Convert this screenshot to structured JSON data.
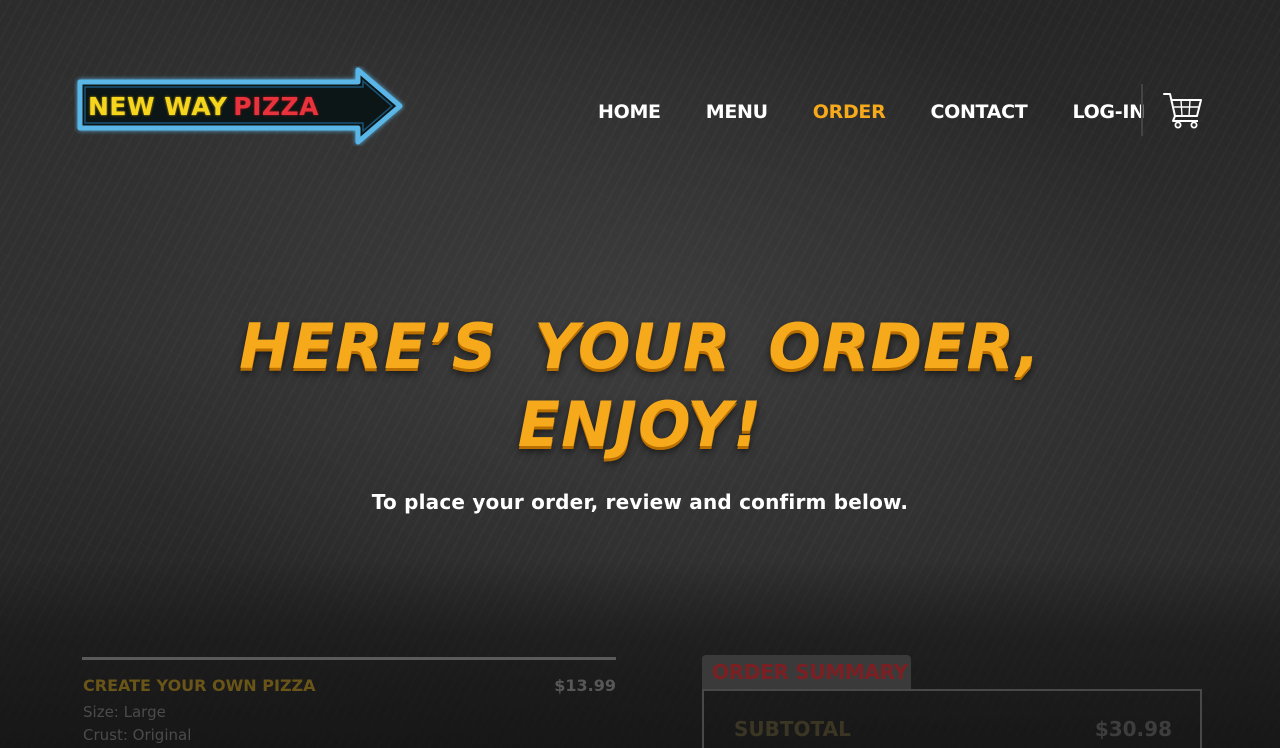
{
  "logo": {
    "word1": "NEW WAY",
    "word2": "PIZZA",
    "glow_color": "#5ab6e6"
  },
  "nav": {
    "items": [
      {
        "label": "HOME",
        "active": false
      },
      {
        "label": "MENU",
        "active": false
      },
      {
        "label": "ORDER",
        "active": true
      },
      {
        "label": "CONTACT",
        "active": false
      },
      {
        "label": "LOG-IN",
        "active": false
      }
    ],
    "cart_icon": "shopping-cart-icon",
    "active_color": "#f6a91a"
  },
  "hero": {
    "title_line1": "HERE’S YOUR ORDER,",
    "title_line2": "ENJOY!",
    "subtitle": "To place your order, review and confirm below."
  },
  "order_item": {
    "name": "CREATE YOUR OWN PIZZA",
    "price": "$13.99",
    "details": [
      "Size: Large",
      "Crust: Original"
    ]
  },
  "summary": {
    "title": "ORDER SUMMARY",
    "subtotal_label": "SUBTOTAL",
    "subtotal_value": "$30.98"
  }
}
